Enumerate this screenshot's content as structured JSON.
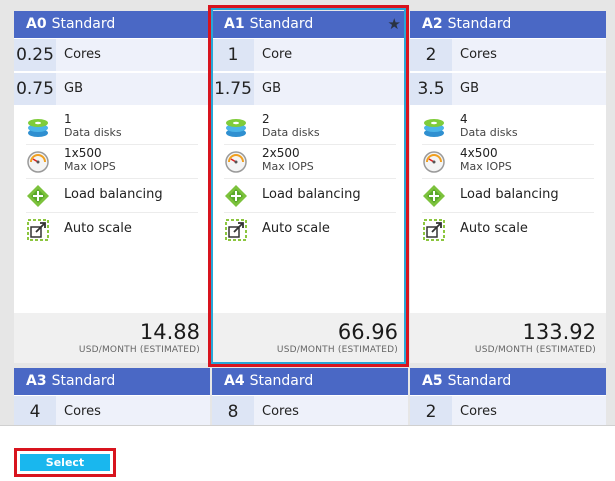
{
  "tiers_top": [
    {
      "code": "A0",
      "name": "Standard",
      "cores": "0.25",
      "cores_label": "Cores",
      "ram": "0.75",
      "ram_label": "GB",
      "disks": "1",
      "disks_label": "Data disks",
      "iops": "1x500",
      "iops_label": "Max IOPS",
      "lb_label": "Load balancing",
      "as_label": "Auto scale",
      "price": "14.88",
      "price_unit": "USD/MONTH (ESTIMATED)"
    },
    {
      "code": "A1",
      "name": "Standard",
      "star": "★",
      "cores": "1",
      "cores_label": "Core",
      "ram": "1.75",
      "ram_label": "GB",
      "disks": "2",
      "disks_label": "Data disks",
      "iops": "2x500",
      "iops_label": "Max IOPS",
      "lb_label": "Load balancing",
      "as_label": "Auto scale",
      "price": "66.96",
      "price_unit": "USD/MONTH (ESTIMATED)"
    },
    {
      "code": "A2",
      "name": "Standard",
      "cores": "2",
      "cores_label": "Cores",
      "ram": "3.5",
      "ram_label": "GB",
      "disks": "4",
      "disks_label": "Data disks",
      "iops": "4x500",
      "iops_label": "Max IOPS",
      "lb_label": "Load balancing",
      "as_label": "Auto scale",
      "price": "133.92",
      "price_unit": "USD/MONTH (ESTIMATED)"
    }
  ],
  "tiers_bottom": [
    {
      "code": "A3",
      "name": "Standard",
      "cores": "4",
      "cores_label": "Cores"
    },
    {
      "code": "A4",
      "name": "Standard",
      "cores": "8",
      "cores_label": "Cores"
    },
    {
      "code": "A5",
      "name": "Standard",
      "cores": "2",
      "cores_label": "Cores"
    }
  ],
  "footer": {
    "select_label": "Select"
  },
  "colors": {
    "header": "#4a68c5",
    "selected_outline": "#d8141e",
    "selected_inner": "#29a6d6",
    "button": "#19b7ee"
  },
  "icons": {
    "disks": "disk-stack-icon",
    "iops": "gauge-icon",
    "lb": "load-balancer-icon",
    "as": "auto-scale-icon",
    "star": "star-icon"
  }
}
